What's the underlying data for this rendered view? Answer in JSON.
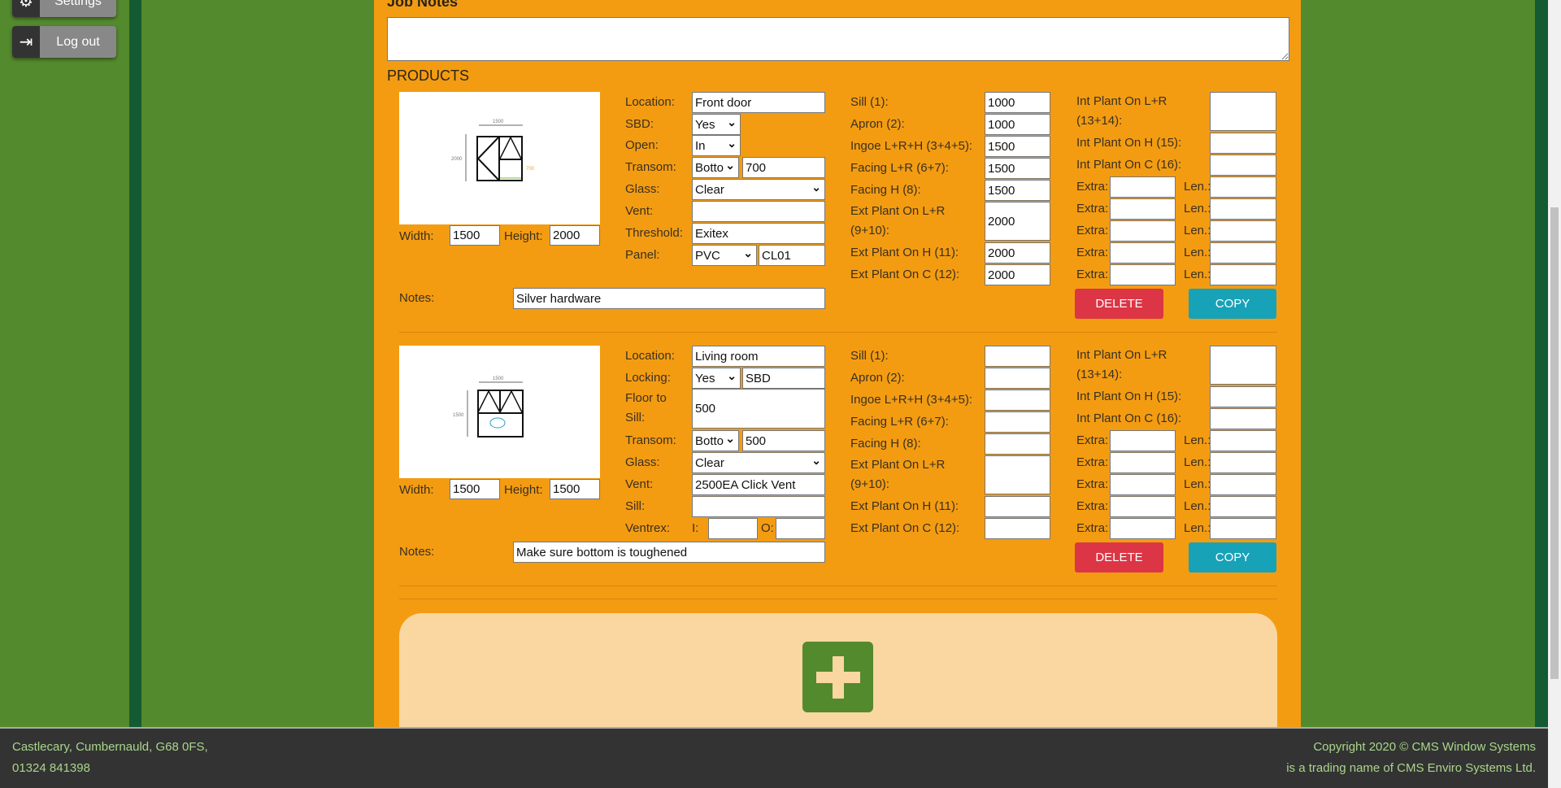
{
  "sidebar": {
    "settings": {
      "label": "Settings",
      "icon": "gear-icon"
    },
    "logout": {
      "label": "Log out",
      "icon": "logout-icon"
    }
  },
  "job_notes": {
    "label": "Job Notes",
    "value": ""
  },
  "products_title": "PRODUCTS",
  "labels": {
    "width": "Width:",
    "height": "Height:",
    "notes": "Notes:",
    "delete": "DELETE",
    "copy": "COPY",
    "extra": "Extra:",
    "len": "Len.:"
  },
  "col3_labels": [
    "Sill (1):",
    "Apron (2):",
    "Ingoe L+R+H (3+4+5):",
    "Facing L+R (6+7):",
    "Facing H (8):",
    "Ext Plant On L+R (9+10):",
    "Ext Plant On H (11):",
    "Ext Plant On C (12):"
  ],
  "col4_labels": [
    "Int Plant On L+R (13+14):",
    "Int Plant On H (15):",
    "Int Plant On C (16):"
  ],
  "products": [
    {
      "width": "1500",
      "height": "2000",
      "notes": "Silver hardware",
      "drawing": {
        "width_dim": "1500",
        "height_dim": "2000",
        "transom_dim": "700"
      },
      "col2": [
        {
          "label": "Location:",
          "values": [
            "Front door"
          ]
        },
        {
          "label": "SBD:",
          "values": [
            "Yes"
          ]
        },
        {
          "label": "Open:",
          "values": [
            "In"
          ]
        },
        {
          "label": "Transom:",
          "values": [
            "Botto",
            "700"
          ]
        },
        {
          "label": "Glass:",
          "values": [
            "Clear"
          ]
        },
        {
          "label": "Vent:",
          "values": [
            ""
          ]
        },
        {
          "label": "Threshold:",
          "values": [
            "Exitex"
          ]
        },
        {
          "label": "Panel:",
          "values": [
            "PVC",
            "CL01"
          ]
        }
      ],
      "col3": [
        "1000",
        "1000",
        "1500",
        "1500",
        "1500",
        "2000",
        "2000",
        "2000"
      ],
      "col4": [
        "",
        "",
        ""
      ],
      "extras": [
        [
          "",
          ""
        ],
        [
          "",
          ""
        ],
        [
          "",
          ""
        ],
        [
          "",
          ""
        ],
        [
          "",
          ""
        ]
      ]
    },
    {
      "width": "1500",
      "height": "1500",
      "notes": "Make sure bottom is toughened",
      "drawing": {
        "width_dim": "1500",
        "height_dim": "1500"
      },
      "col2": [
        {
          "label": "Location:",
          "values": [
            "Living room"
          ]
        },
        {
          "label": "Locking:",
          "values": [
            "Yes",
            "SBD"
          ]
        },
        {
          "label": "Floor to Sill:",
          "values": [
            "500"
          ]
        },
        {
          "label": "Transom:",
          "values": [
            "Botto",
            "500"
          ]
        },
        {
          "label": "Glass:",
          "values": [
            "Clear"
          ]
        },
        {
          "label": "Vent:",
          "values": [
            "2500EA Click Vent"
          ]
        },
        {
          "label": "Sill:",
          "values": [
            ""
          ]
        },
        {
          "label": "Ventrex:",
          "sub_labels": [
            "I:",
            "O:"
          ],
          "values": [
            "",
            ""
          ]
        }
      ],
      "col3": [
        "",
        "",
        "",
        "",
        "",
        "",
        "",
        ""
      ],
      "col4": [
        "",
        "",
        ""
      ],
      "extras": [
        [
          "",
          ""
        ],
        [
          "",
          ""
        ],
        [
          "",
          ""
        ],
        [
          "",
          ""
        ],
        [
          "",
          ""
        ]
      ]
    }
  ],
  "add_product": {
    "icon": "plus-icon"
  },
  "footer": {
    "address": "Castlecary, Cumbernauld, G68 0FS,",
    "phone": "01324 841398",
    "copyright": "Copyright 2020 © CMS Window Systems",
    "trading": "is a trading name of CMS Enviro Systems Ltd."
  },
  "colors": {
    "panel": "#f39c12",
    "background": "#548a2e",
    "delete": "#dc3545",
    "copy": "#17a2b8",
    "add_box": "#fad7a0",
    "footer": "#333333"
  }
}
